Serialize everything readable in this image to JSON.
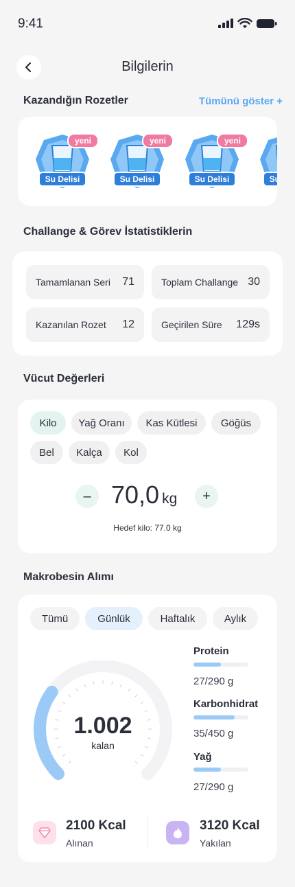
{
  "status": {
    "time": "9:41"
  },
  "header": {
    "title": "Bilgilerin"
  },
  "badges": {
    "title": "Kazandığın Rozetler",
    "show_all": "Tümünü göster +",
    "items": [
      {
        "label": "Su Delisi",
        "new": "yeni"
      },
      {
        "label": "Su Delisi",
        "new": "yeni"
      },
      {
        "label": "Su Delisi",
        "new": "yeni"
      },
      {
        "label": "Su Delisi",
        "new": ""
      }
    ]
  },
  "stats": {
    "title": "Challange & Görev İstatistiklerin",
    "items": [
      {
        "label": "Tamamlanan Seri",
        "value": "71"
      },
      {
        "label": "Toplam Challange",
        "value": "30"
      },
      {
        "label": "Kazanılan Rozet",
        "value": "12"
      },
      {
        "label": "Geçirilen Süre",
        "value": "129s"
      }
    ]
  },
  "body_values": {
    "title": "Vücut Değerleri",
    "chips": [
      "Kilo",
      "Yağ Oranı",
      "Kas Kütlesi",
      "Göğüs",
      "Bel",
      "Kalça",
      "Kol"
    ],
    "selected": "Kilo",
    "minus": "–",
    "plus": "+",
    "value": "70,0",
    "unit": "kg",
    "target": "Hedef kilo: 77.0 kg"
  },
  "macros": {
    "title": "Makrobesin Alımı",
    "tabs": [
      "Tümü",
      "Günlük",
      "Haftalık",
      "Aylık"
    ],
    "selected_tab": "Günlük",
    "remaining_value": "1.002",
    "remaining_label": "kalan",
    "remaining_progress": 0.3,
    "items": [
      {
        "name": "Protein",
        "amount": "27/290 g",
        "progress": 0.5
      },
      {
        "name": "Karbonhidrat",
        "amount": "35/450 g",
        "progress": 0.75
      },
      {
        "name": "Yağ",
        "amount": "27/290 g",
        "progress": 0.5
      }
    ],
    "intake": {
      "value": "2100 Kcal",
      "label": "Alınan"
    },
    "burned": {
      "value": "3120 Kcal",
      "label": "Yakılan"
    },
    "colors": {
      "accent": "#9ccaf6",
      "intake_icon_bg": "#fde0ea",
      "burned_icon_bg": "#c9b4f3"
    }
  }
}
